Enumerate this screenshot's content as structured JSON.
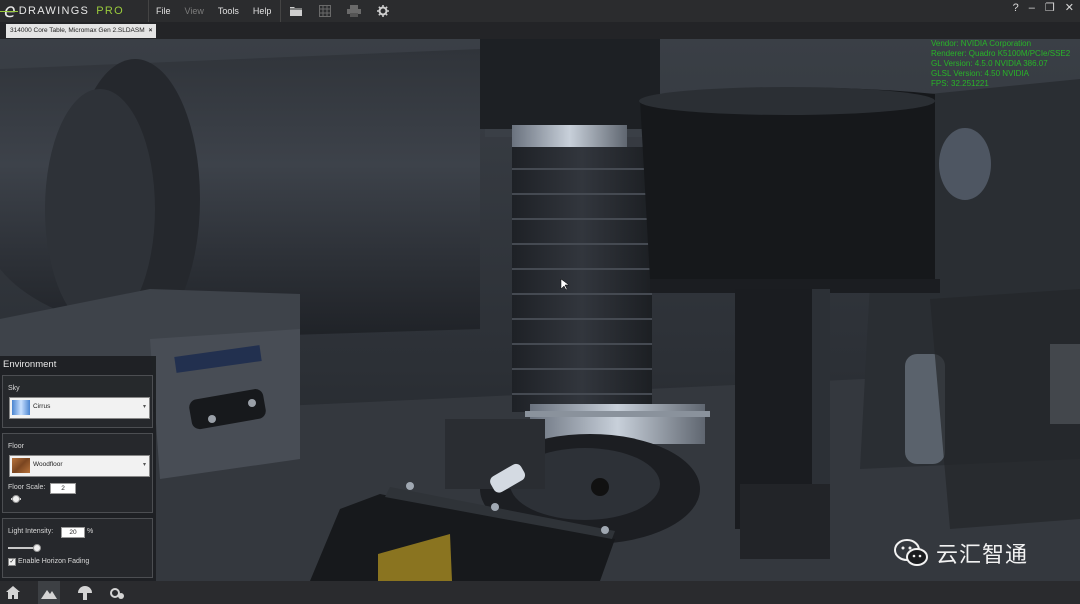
{
  "app": {
    "brand_letter": "e",
    "brand_name": "DRAWINGS",
    "brand_edition": "PRO"
  },
  "menu": [
    {
      "label": "File",
      "enabled": true
    },
    {
      "label": "View",
      "enabled": false
    },
    {
      "label": "Tools",
      "enabled": true
    },
    {
      "label": "Help",
      "enabled": true
    }
  ],
  "toolbar": {
    "icons": [
      "open-folder-icon",
      "grid-icon",
      "print-icon",
      "settings-gear-icon"
    ]
  },
  "window_controls": {
    "help": "?",
    "minimize": "–",
    "restore": "❐",
    "close": "✕"
  },
  "tab": {
    "label": "314000 Core Table, Micromax Gen 2.SLDASM",
    "close": "×"
  },
  "render_info": [
    "Vendor: NVIDIA Corporation",
    "Renderer: Quadro K5100M/PCIe/SSE2",
    "GL Version: 4.5.0 NVIDIA 386.07",
    "GLSL Version: 4.50 NVIDIA",
    "FPS: 32.251221"
  ],
  "environment": {
    "title": "Environment",
    "sky": {
      "label": "Sky",
      "value": "Cirrus",
      "swatch": "#7fb0e8"
    },
    "floor": {
      "label": "Floor",
      "value": "Woodfloor",
      "swatch": "#9a5a2c",
      "scale_label": "Floor Scale:",
      "scale_value": "2",
      "scale_slider": 0.0
    },
    "lighting": {
      "label": "Light Intensity:",
      "value": "20",
      "unit": "%",
      "slider": 0.2,
      "fading_label": "Enable Horizon Fading",
      "fading_checked": true
    }
  },
  "bottom_toolbar": {
    "icons": [
      "home-icon",
      "environment-mountain-icon",
      "mushroom-icon",
      "model-gear-icon"
    ]
  },
  "watermark": {
    "text": "云汇智通"
  },
  "colors": {
    "accent_green": "#9acb3c",
    "info_green": "#28b528"
  }
}
